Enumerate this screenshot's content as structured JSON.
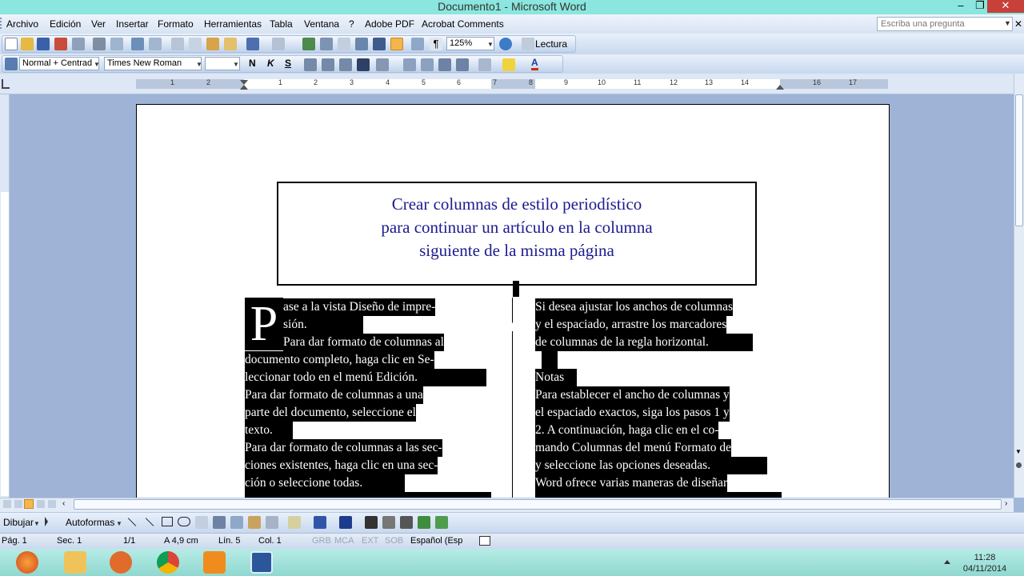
{
  "window": {
    "title": "Documento1 - Microsoft Word",
    "minimize_glyph": "–",
    "restore_glyph": "❐",
    "close_glyph": "✕"
  },
  "menu": {
    "items": [
      "Archivo",
      "Edición",
      "Ver",
      "Insertar",
      "Formato",
      "Herramientas",
      "Tabla",
      "Ventana",
      "?",
      "Adobe PDF",
      "Acrobat Comments"
    ],
    "ask_placeholder": "Escriba una pregunta",
    "doc_close_glyph": "✕"
  },
  "toolbar_standard": {
    "zoom": "125%",
    "reading_label": "Lectura"
  },
  "toolbar_format": {
    "style": "Normal + Centrad",
    "font": "Times New Roman",
    "size": "",
    "bold": "N",
    "italic": "K",
    "underline": "S",
    "font_color_glyph": "A"
  },
  "ruler": {
    "numbers": [
      "1",
      "2",
      "1",
      "1",
      "2",
      "3",
      "4",
      "5",
      "6",
      "7",
      "8",
      "9",
      "10",
      "11",
      "12",
      "13",
      "14",
      "15",
      "16",
      "17"
    ]
  },
  "document": {
    "title_lines": [
      "Crear columnas de estilo periodístico",
      "para continuar un artículo en la columna",
      "siguiente de la misma página"
    ],
    "dropcap": "P",
    "col1_lines": [
      "ase a la vista Diseño de impre-",
      "sión.",
      "Para dar formato de columnas al",
      "documento completo, haga clic en Se-",
      "leccionar todo en el menú Edición.",
      "Para dar formato de columnas a una",
      "parte del documento, seleccione el",
      "texto.",
      "Para dar formato de columnas a las sec-",
      "ciones existentes, haga clic en una sec-",
      "ción o seleccione todas."
    ],
    "col2_lines": [
      "Si desea ajustar los anchos de columnas",
      "y el espaciado, arrastre los marcadores",
      "de columnas de la regla horizontal.",
      "",
      "Notas",
      "Para establecer el ancho de columnas y",
      "el espaciado exactos, siga los pasos 1 y",
      "2. A continuación, haga clic en el co-",
      "mando Columnas del menú Formato de",
      "y seleccione las opciones deseadas.",
      "Word ofrece varias maneras de diseñar"
    ]
  },
  "drawing_toolbar": {
    "draw_label": "Dibujar",
    "autoshapes_label": "Autoformas"
  },
  "status": {
    "page": "Pág. 1",
    "section": "Sec. 1",
    "pages": "1/1",
    "at": "A 4,9 cm",
    "line": "Lín. 5",
    "col": "Col. 1",
    "rec": "GRB",
    "trk": "MCA",
    "ext": "EXT",
    "ovr": "SOB",
    "language": "Español (Esp"
  },
  "taskbar": {
    "time": "11:28",
    "date": "04/11/2014"
  },
  "colors": {
    "title_text": "#1b1b8f",
    "selection": "#000000",
    "titlebar": "#8ae6de",
    "close": "#c7403a"
  }
}
